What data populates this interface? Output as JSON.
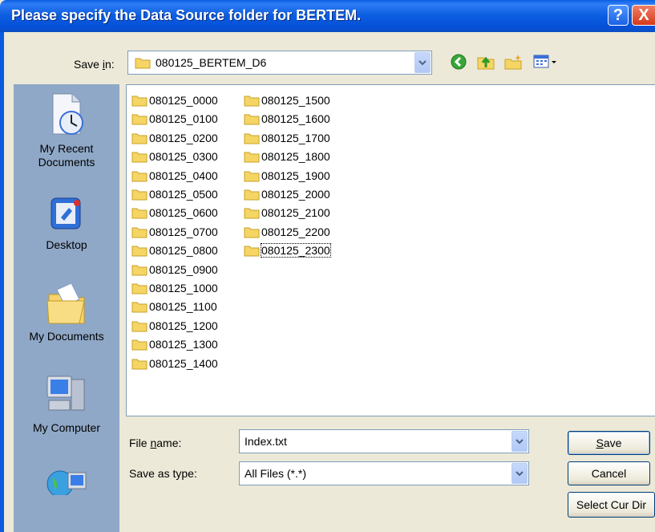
{
  "dialog": {
    "title": "Please specify the Data Source folder for BERTEM.",
    "help_glyph": "?",
    "close_glyph": "X"
  },
  "save_in": {
    "label_pre": "Save ",
    "label_u": "i",
    "label_post": "n:",
    "value": "080125_BERTEM_D6"
  },
  "toolbar": {
    "icons": [
      "back-icon",
      "up-folder-icon",
      "new-folder-icon",
      "view-menu-icon"
    ]
  },
  "places": [
    {
      "label": "My Recent Documents",
      "icon": "recent-documents-icon"
    },
    {
      "label": "Desktop",
      "icon": "desktop-icon"
    },
    {
      "label": "My Documents",
      "icon": "my-documents-icon"
    },
    {
      "label": "My Computer",
      "icon": "my-computer-icon"
    },
    {
      "label": "",
      "icon": "network-places-icon"
    }
  ],
  "folders_col1": [
    "080125_0000",
    "080125_0100",
    "080125_0200",
    "080125_0300",
    "080125_0400",
    "080125_0500",
    "080125_0600",
    "080125_0700",
    "080125_0800",
    "080125_0900",
    "080125_1000",
    "080125_1100",
    "080125_1200",
    "080125_1300",
    "080125_1400"
  ],
  "folders_col2": [
    "080125_1500",
    "080125_1600",
    "080125_1700",
    "080125_1800",
    "080125_1900",
    "080125_2000",
    "080125_2100",
    "080125_2200",
    "080125_2300"
  ],
  "focused_folder": "080125_2300",
  "file_name": {
    "label_pre": "File ",
    "label_u": "n",
    "label_post": "ame:",
    "value": "Index.txt"
  },
  "save_as_type": {
    "label": "Save as type:",
    "value": "All Files (*.*)"
  },
  "buttons": {
    "save_u": "S",
    "save_rest": "ave",
    "cancel": "Cancel",
    "select_cur_dir": "Select Cur Dir"
  },
  "colors": {
    "title_bar": "#0a5ee0",
    "places_bar": "#8fa8c7",
    "folder": "#f5d564",
    "dialog_bg": "#ece9d8"
  }
}
